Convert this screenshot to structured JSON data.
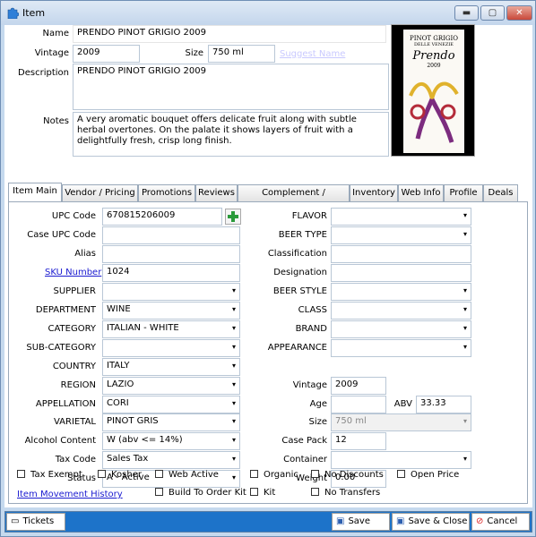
{
  "window": {
    "title": "Item",
    "minimize": "▬",
    "maximize": "▢",
    "close": "✕"
  },
  "top": {
    "name_label": "Name",
    "name_value": "PRENDO PINOT GRIGIO 2009",
    "vintage_label": "Vintage",
    "vintage_value": "2009",
    "size_label": "Size",
    "size_value": "750 ml",
    "suggest_link": "Suggest Name",
    "description_label": "Description",
    "description_value": "PRENDO PINOT GRIGIO 2009",
    "notes_label": "Notes",
    "notes_value": "A very aromatic bouquet offers delicate fruit along with subtle herbal overtones. On the palate it shows layers of fruit with a delightfully fresh, crisp long finish."
  },
  "photo": {
    "label_line1": "PINOT GRIGIO",
    "label_line2": "DELLE VENEZIE",
    "brand": "Prendo",
    "year": "2009"
  },
  "tabs": [
    "Item Main",
    "Vendor / Pricing",
    "Promotions",
    "Reviews",
    "Complement / Substitute",
    "Inventory",
    "Web Info",
    "Profile",
    "Deals"
  ],
  "left": {
    "upc": {
      "label": "UPC Code",
      "value": "670815206009"
    },
    "case_upc": {
      "label": "Case UPC Code",
      "value": ""
    },
    "alias": {
      "label": "Alias",
      "value": ""
    },
    "sku": {
      "label": "SKU Number",
      "value": "1024"
    },
    "supplier": {
      "label": "SUPPLIER",
      "value": ""
    },
    "department": {
      "label": "DEPARTMENT",
      "value": "WINE"
    },
    "category": {
      "label": "CATEGORY",
      "value": "ITALIAN - WHITE"
    },
    "subcategory": {
      "label": "SUB-CATEGORY",
      "value": ""
    },
    "country": {
      "label": "COUNTRY",
      "value": "ITALY"
    },
    "region": {
      "label": "REGION",
      "value": "LAZIO"
    },
    "appellation": {
      "label": "APPELLATION",
      "value": "CORI"
    },
    "varietal": {
      "label": "VARIETAL",
      "value": "PINOT GRIS"
    },
    "alcohol": {
      "label": "Alcohol Content",
      "value": "W (abv <= 14%)"
    },
    "taxcode": {
      "label": "Tax Code",
      "value": "Sales Tax"
    },
    "status": {
      "label": "Status",
      "value": "A - Active"
    }
  },
  "right": {
    "flavor": {
      "label": "FLAVOR",
      "value": ""
    },
    "beertype": {
      "label": "BEER TYPE",
      "value": ""
    },
    "classification": {
      "label": "Classification",
      "value": ""
    },
    "designation": {
      "label": "Designation",
      "value": ""
    },
    "beerstyle": {
      "label": "BEER STYLE",
      "value": ""
    },
    "class": {
      "label": "CLASS",
      "value": ""
    },
    "brand": {
      "label": "BRAND",
      "value": ""
    },
    "appearance": {
      "label": "APPEARANCE",
      "value": ""
    },
    "vintage": {
      "label": "Vintage",
      "value": "2009"
    },
    "age": {
      "label": "Age",
      "value": ""
    },
    "abv": {
      "label": "ABV",
      "value": "33.33"
    },
    "size": {
      "label": "Size",
      "value": "750 ml"
    },
    "casepack": {
      "label": "Case Pack",
      "value": "12"
    },
    "container": {
      "label": "Container",
      "value": ""
    },
    "weight": {
      "label": "Weight",
      "value": "0.00"
    }
  },
  "checks": {
    "tax_exempt": "Tax Exempt",
    "kosher": "Kosher",
    "web_active": "Web Active",
    "organic": "Organic",
    "no_discounts": "No Discounts",
    "open_price": "Open Price",
    "build_to_order": "Build To Order Kit",
    "kit": "Kit",
    "no_transfers": "No Transfers"
  },
  "movement_link": "Item Movement History",
  "bottom": {
    "tickets": "Tickets",
    "save": "Save",
    "save_close": "Save & Close",
    "cancel": "Cancel"
  },
  "colors": {
    "accent": "#1d73c9",
    "link": "#1a1ad0",
    "chrome": "#c5d9ee"
  }
}
